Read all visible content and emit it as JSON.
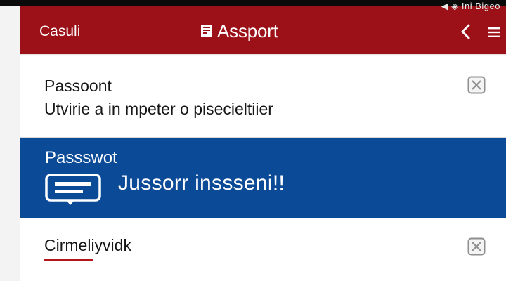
{
  "status_bar": {
    "text": "◀ ◈ Ini Bigeo"
  },
  "app_bar": {
    "left_label": "Casuli",
    "title": "Assport",
    "title_icon": "document-icon",
    "back_icon": "chevron-left-icon",
    "menu_icon": "hamburger-menu-icon",
    "background": "#9c1118"
  },
  "list": {
    "items": [
      {
        "title": "Passoont",
        "subtitle": "Utvirie a in mpeter o pisecieltiier",
        "action_icon": "close-box-icon"
      },
      {
        "title": "Passswot",
        "highlight_text": "Jussorr inssseni!!",
        "icon": "id-card-icon",
        "background": "#0b4a97"
      },
      {
        "title": "Cirmeliyvidk",
        "action_icon": "close-box-icon",
        "underline_color": "#b5151d"
      }
    ]
  }
}
